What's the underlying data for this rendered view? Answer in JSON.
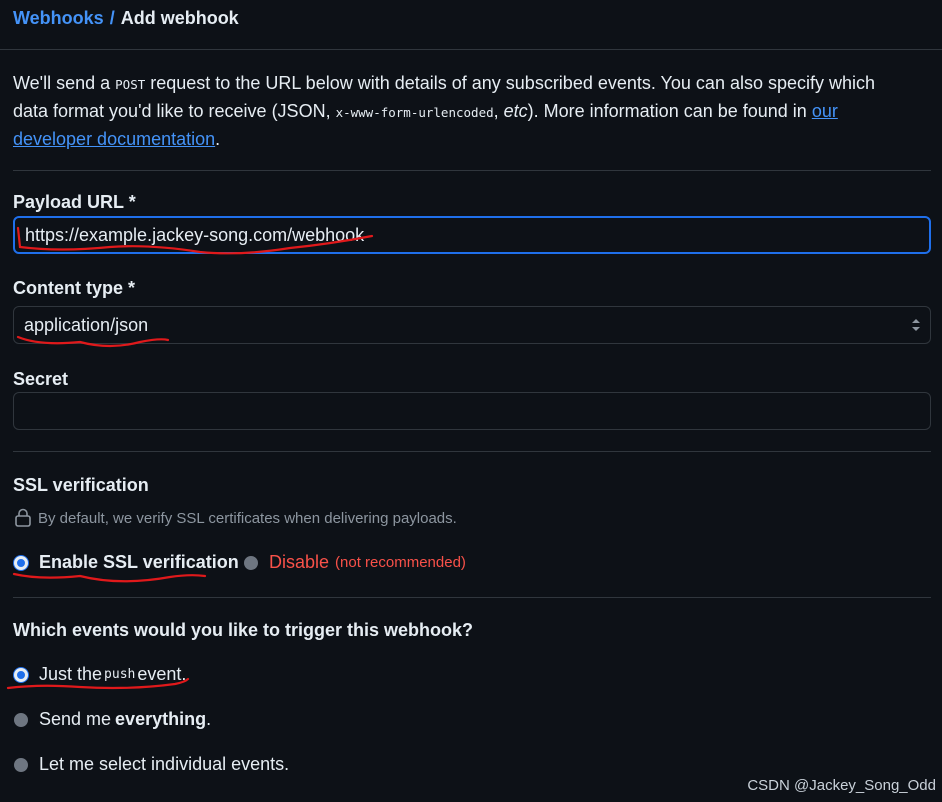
{
  "breadcrumb": {
    "parent": "Webhooks",
    "separator": "/",
    "current": "Add webhook"
  },
  "intro": {
    "t1": "We'll send a ",
    "method": "POST",
    "t2": " request to the URL below with details of any subscribed events. You can also specify which data format you'd like to receive (JSON, ",
    "format": "x-www-form-urlencoded",
    "t3": ", ",
    "etc": "etc",
    "t4": "). More information can be found in ",
    "link": "our developer documentation",
    "t5": "."
  },
  "payload_url": {
    "label": "Payload URL *",
    "value": "https://example.jackey-song.com/webhook"
  },
  "content_type": {
    "label": "Content type *",
    "value": "application/json"
  },
  "secret": {
    "label": "Secret",
    "value": ""
  },
  "ssl": {
    "label": "SSL verification",
    "hint": "By default, we verify SSL certificates when delivering payloads.",
    "enable": "Enable SSL verification",
    "disable": "Disable",
    "disable_note": "(not recommended)"
  },
  "events": {
    "question": "Which events would you like to trigger this webhook?",
    "opt1_a": "Just the ",
    "opt1_code": "push",
    "opt1_b": " event.",
    "opt2_a": "Send me ",
    "opt2_b": "everything",
    "opt2_c": ".",
    "opt3": "Let me select individual events."
  },
  "watermark": "CSDN @Jackey_Song_Odd",
  "colors": {
    "accent": "#1f6feb",
    "link": "#4493f8",
    "danger": "#f85149",
    "annotation": "#e0191b"
  }
}
